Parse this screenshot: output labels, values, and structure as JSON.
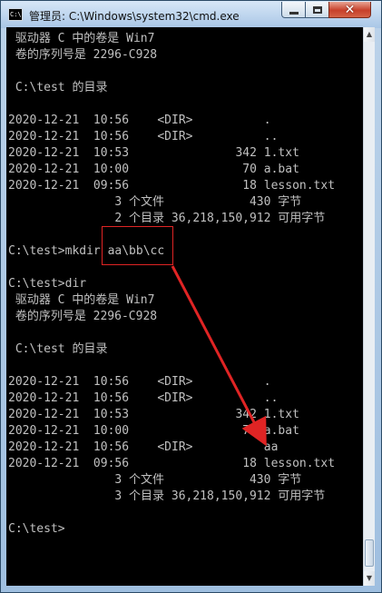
{
  "window": {
    "title": "管理员: C:\\Windows\\system32\\cmd.exe",
    "icon_text": "C:\\",
    "minimize_icon": "minimize-icon",
    "maximize_icon": "maximize-icon",
    "close_icon": "close-icon",
    "close_glyph": "✕"
  },
  "scrollbar": {
    "up_glyph": "▲",
    "down_glyph": "▼"
  },
  "console": {
    "lines": [
      " 驱动器 C 中的卷是 Win7",
      " 卷的序列号是 2296-C928",
      "",
      " C:\\test 的目录",
      "",
      "2020-12-21  10:56    <DIR>          .",
      "2020-12-21  10:56    <DIR>          ..",
      "2020-12-21  10:53               342 1.txt",
      "2020-12-21  10:00                70 a.bat",
      "2020-12-21  09:56                18 lesson.txt",
      "               3 个文件            430 字节",
      "               2 个目录 36,218,150,912 可用字节",
      "",
      "C:\\test>mkdir aa\\bb\\cc",
      "",
      "C:\\test>dir",
      " 驱动器 C 中的卷是 Win7",
      " 卷的序列号是 2296-C928",
      "",
      " C:\\test 的目录",
      "",
      "2020-12-21  10:56    <DIR>          .",
      "2020-12-21  10:56    <DIR>          ..",
      "2020-12-21  10:53               342 1.txt",
      "2020-12-21  10:00                70 a.bat",
      "2020-12-21  10:56    <DIR>          aa",
      "2020-12-21  09:56                18 lesson.txt",
      "               3 个文件            430 字节",
      "               3 个目录 36,218,150,912 可用字节",
      "",
      "C:\\test>"
    ]
  },
  "colors": {
    "console_bg": "#000000",
    "console_text": "#c0c0c0",
    "annotation": "#e02424"
  }
}
